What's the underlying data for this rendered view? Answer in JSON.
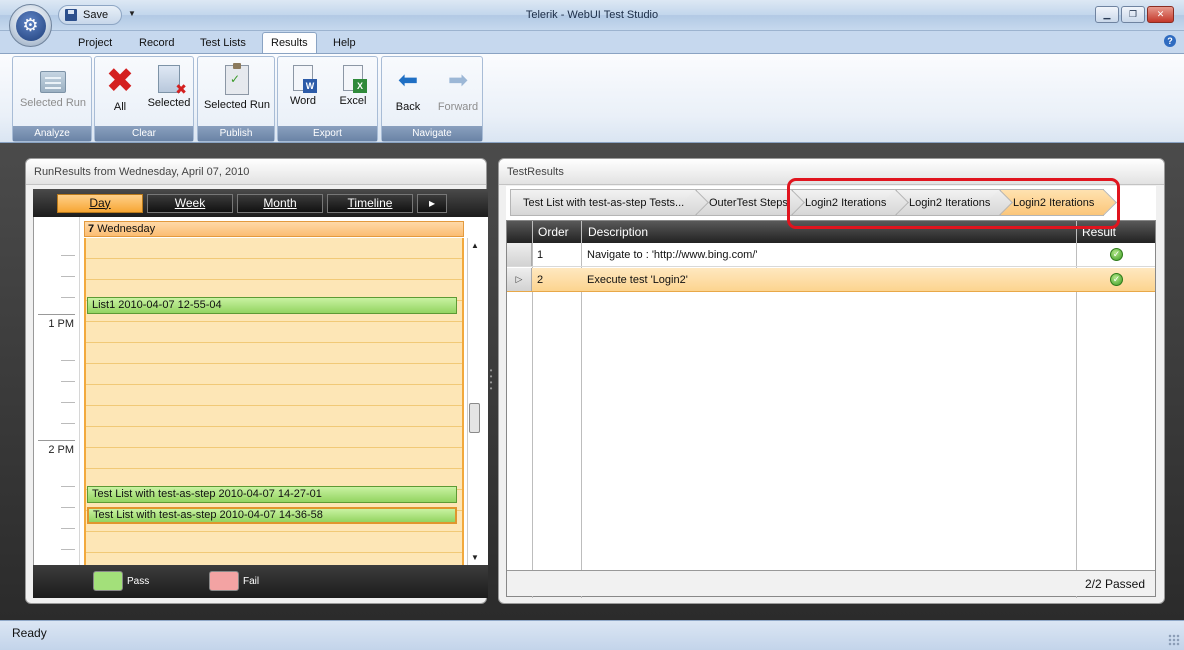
{
  "window": {
    "title": "Telerik - WebUI Test Studio",
    "qat_save": "Save"
  },
  "ribbon": {
    "tabs": [
      "Project",
      "Record",
      "Test Lists",
      "Results",
      "Help"
    ],
    "active_tab": "Results",
    "groups": {
      "analyze": {
        "label": "Analyze",
        "buttons": [
          "Selected Run"
        ]
      },
      "clear": {
        "label": "Clear",
        "buttons": [
          "All",
          "Selected"
        ]
      },
      "publish": {
        "label": "Publish",
        "buttons": [
          "Selected Run"
        ]
      },
      "export": {
        "label": "Export",
        "buttons": [
          "Word",
          "Excel"
        ]
      },
      "navigate": {
        "label": "Navigate",
        "buttons": [
          "Back",
          "Forward"
        ]
      }
    }
  },
  "run_results": {
    "title": "RunResults from Wednesday, April 07, 2010",
    "views": [
      "Day",
      "Week",
      "Month",
      "Timeline"
    ],
    "active_view": "Day",
    "day_number": "7",
    "day_name": "Wednesday",
    "times": [
      "1 PM",
      "2 PM"
    ],
    "appointments": [
      {
        "label": "List1 2010-04-07 12-55-04",
        "status": "pass"
      },
      {
        "label": "Test List with test-as-step 2010-04-07 14-27-01",
        "status": "pass"
      },
      {
        "label": "Test List with test-as-step 2010-04-07 14-36-58",
        "status": "pass",
        "selected": true
      }
    ],
    "legend": {
      "pass": "Pass",
      "fail": "Fail",
      "pass_color": "#a3e07a",
      "fail_color": "#f3a3a3"
    }
  },
  "test_results": {
    "title": "TestResults",
    "breadcrumbs": [
      "Test List with test-as-step Tests...",
      "OuterTest Steps",
      "Login2 Iterations",
      "Login2 Iterations",
      "Login2 Iterations"
    ],
    "columns": {
      "order": "Order",
      "description": "Description",
      "result": "Result"
    },
    "rows": [
      {
        "order": "1",
        "description": "Navigate to : 'http://www.bing.com/'",
        "result": "pass"
      },
      {
        "order": "2",
        "description": "Execute test 'Login2'",
        "result": "pass"
      }
    ],
    "summary": "2/2 Passed"
  },
  "status": {
    "text": "Ready"
  }
}
